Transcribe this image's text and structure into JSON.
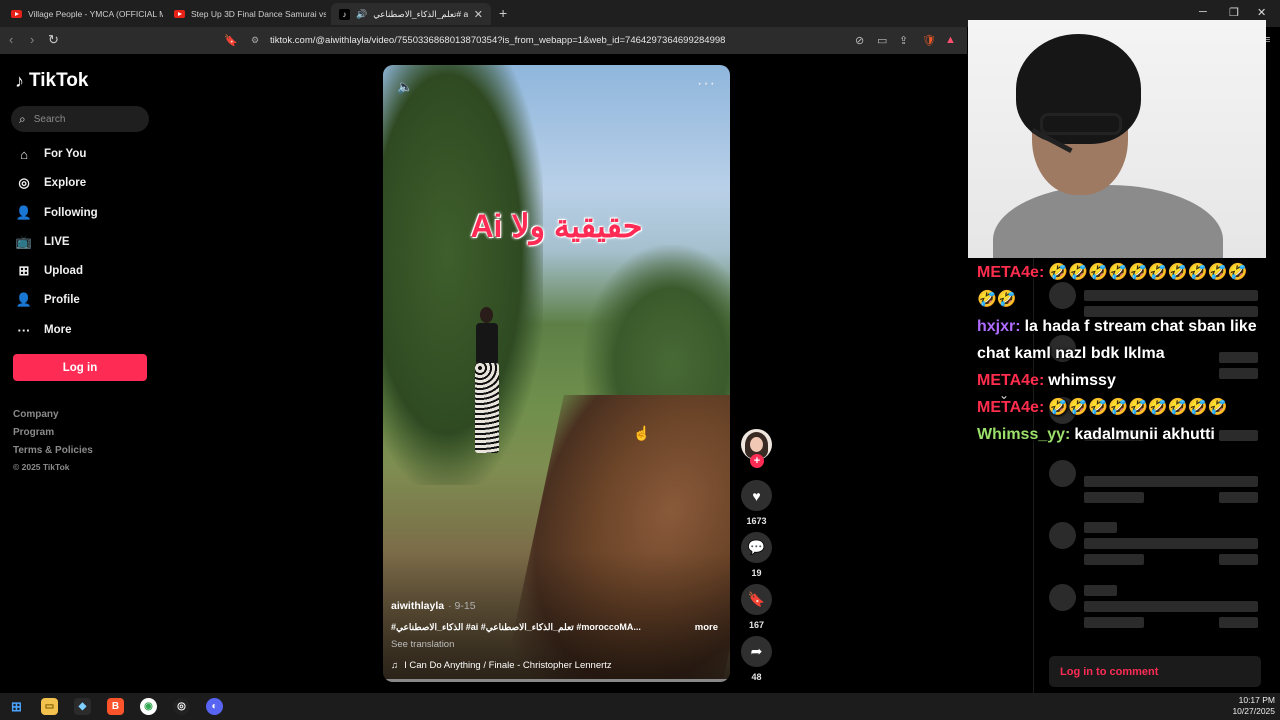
{
  "browser": {
    "tabs": [
      {
        "title": "Village People - YMCA (OFFICIAL Mu",
        "favicon": "youtube-icon"
      },
      {
        "title": "Step Up 3D Final Dance Samurai vs F",
        "favicon": "youtube-icon"
      },
      {
        "title": "تعلم_الذكاء_الاصطناعي# ai# ...",
        "favicon": "tiktok-icon",
        "active": true
      }
    ],
    "url": "tiktok.com/@aiwithlayla/video/7550336868013870354?is_from_webapp=1&web_id=7464297364699284998"
  },
  "sidebar": {
    "logo": "TikTok",
    "search_placeholder": "Search",
    "nav": [
      {
        "label": "For You",
        "icon": "home-icon"
      },
      {
        "label": "Explore",
        "icon": "compass-icon"
      },
      {
        "label": "Following",
        "icon": "following-icon"
      },
      {
        "label": "LIVE",
        "icon": "live-icon"
      },
      {
        "label": "Upload",
        "icon": "upload-icon"
      },
      {
        "label": "Profile",
        "icon": "profile-icon"
      },
      {
        "label": "More",
        "icon": "more-icon"
      }
    ],
    "login_label": "Log in",
    "footer": [
      "Company",
      "Program",
      "Terms & Policies",
      "© 2025 TikTok"
    ]
  },
  "video": {
    "overlay_text": "حقيقية ولا Ai",
    "author": "aiwithlayla",
    "date": "· 9-15",
    "caption": "#الذكاء_الاصطناعي #ai #تعلم_الذكاء_الاصطناعي #moroccoMA...",
    "more_label": "more",
    "see_translation": "See translation",
    "music": "I Can Do Anything / Finale - Christopher Lennertz"
  },
  "actions": {
    "likes": "1673",
    "comments": "19",
    "saves": "167",
    "shares": "48"
  },
  "comments_panel": {
    "login_label": "Log in to comment"
  },
  "chat": [
    {
      "user": "META4e:",
      "color": "#ff2d4d",
      "text": "🤣🤣🤣🤣🤣🤣🤣🤣🤣🤣🤣🤣"
    },
    {
      "user": "hxjxr:",
      "color": "#b06cff",
      "text": "la hada f stream chat sban like chat kaml nazl bdk lklma"
    },
    {
      "user": "META4e:",
      "color": "#ff2d4d",
      "text": "whimssy"
    },
    {
      "user": "META4e:",
      "color": "#ff2d4d",
      "text": "🤣🤣🤣🤣🤣🤣🤣🤣🤣"
    },
    {
      "user": "Whimss_yy:",
      "color": "#9be06a",
      "text": "kadalmunii akhutti"
    }
  ],
  "taskbar": {
    "time": "10:17 PM",
    "date": "10/27/2025"
  }
}
